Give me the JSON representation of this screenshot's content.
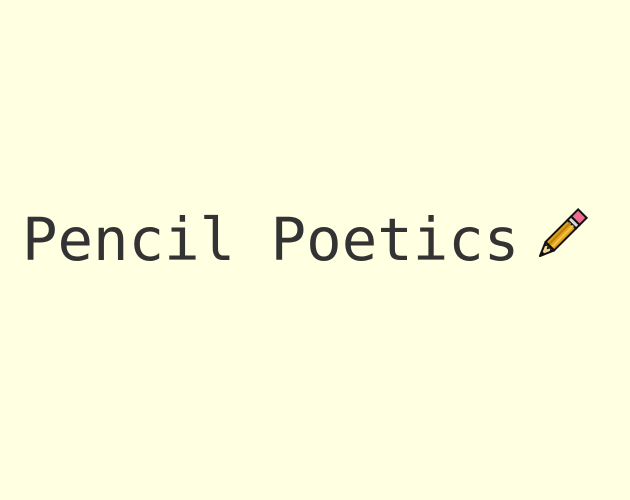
{
  "logo": {
    "title": "Pencil Poetics",
    "icon": "pencil-icon"
  },
  "colors": {
    "background": "#ffffe1",
    "text": "#333333",
    "pencil_body": "#e0a21b",
    "pencil_shadow": "#b97f0f",
    "pencil_eraser": "#f06b8d",
    "pencil_outline": "#111111",
    "pencil_wood": "#efd39b"
  }
}
